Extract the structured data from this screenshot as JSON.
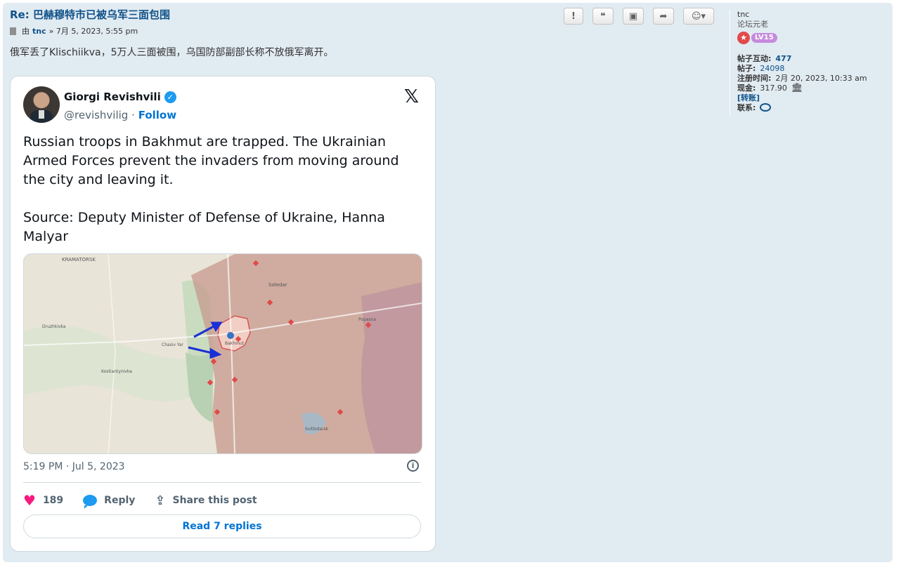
{
  "post": {
    "title": "Re: 巴赫穆特市已被乌军三面包围",
    "meta_by": "由",
    "meta_author": "tnc",
    "meta_date": "» 7月 5, 2023, 5:55 pm",
    "body": "俄军丢了Klischiikva，5万人三面被围，乌国防部副部长称不放俄军离开。"
  },
  "actions": [
    {
      "icon": "exclamation-icon",
      "glyph": "!"
    },
    {
      "icon": "quote-icon",
      "glyph": "❝"
    },
    {
      "icon": "gift-icon",
      "glyph": "▣"
    },
    {
      "icon": "share-icon",
      "glyph": "➦"
    },
    {
      "icon": "emoji-icon",
      "glyph": "☺▾"
    }
  ],
  "tweet": {
    "name": "Giorgi Revishvili",
    "handle": "@revishvilig",
    "separator": "·",
    "follow": "Follow",
    "text": "Russian troops in Bakhmut are trapped. The Ukrainian Armed Forces prevent the invaders from moving around the city and leaving it.\n\nSource: Deputy Minister of Defense of Ukraine, Hanna Malyar",
    "time": "5:19 PM · Jul 5, 2023",
    "likes": "189",
    "reply": "Reply",
    "share": "Share this post",
    "read_replies": "Read 7 replies",
    "map_labels": {
      "kramatorsk": "KRAMATORSK",
      "soledar": "Soledar",
      "bakhmut": "Bakhmut",
      "chasiv_yar": "Chasiv Yar",
      "druzhkivka": "Druzhkivka",
      "kostiantynivka": "Kostiantynivka",
      "svitlodarsk": "Svitlodarsk",
      "popasna": "Popasna"
    }
  },
  "profile": {
    "username": "tnc",
    "rank": "论坛元老",
    "level": "LV15",
    "interaction_label": "帖子互动:",
    "interaction_value": "477",
    "posts_label": "帖子:",
    "posts_value": "24098",
    "joined_label": "注册时间:",
    "joined_value": "2月 20, 2023, 10:33 am",
    "cash_label": "现金:",
    "cash_value": "317.90",
    "transfer": "[转账]",
    "contact_label": "联系:"
  }
}
